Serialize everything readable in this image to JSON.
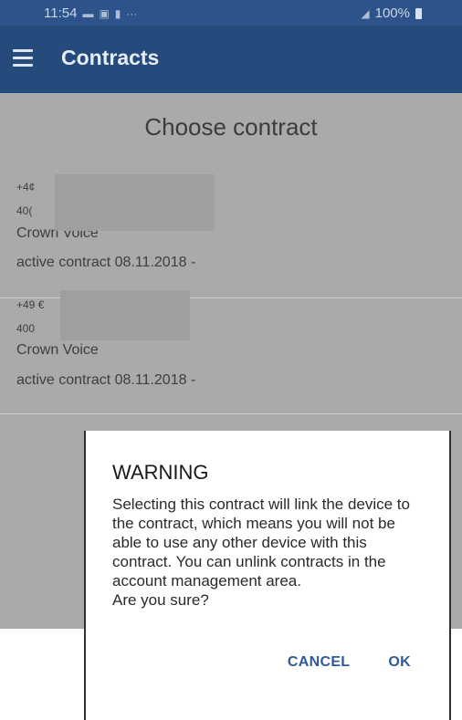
{
  "status_bar": {
    "time": "11:54",
    "notification_icons": [
      "sim-icon",
      "image-icon",
      "app-icon",
      "more-dots-icon"
    ],
    "more": "···",
    "signal": "wifi-signal-icon",
    "battery_text": "100%"
  },
  "app_bar": {
    "title": "Contracts",
    "menu_icon": "hamburger-menu-icon"
  },
  "list": {
    "heading": "Choose contract",
    "contracts": [
      {
        "phone_prefix": "+4¢",
        "number_prefix": "40(",
        "plan": "Crown Voice",
        "status": "active contract 08.11.2018 -"
      },
      {
        "phone_prefix": "+49 €",
        "number_prefix": "400",
        "plan": "Crown Voice",
        "status": "active contract 08.11.2018 -"
      }
    ]
  },
  "dialog": {
    "title": "WARNING",
    "message": "Selecting this contract will link the device to the contract, which means you will not be able to use any other device with this contract. You can unlink contracts in the account management area.\n Are you sure?",
    "cancel_label": "CANCEL",
    "ok_label": "OK"
  },
  "colors": {
    "status_bar": "#2d548a",
    "app_bar": "#254a7c",
    "dim_background": "#aaaaaa",
    "dialog_button": "#2f5a9a"
  }
}
